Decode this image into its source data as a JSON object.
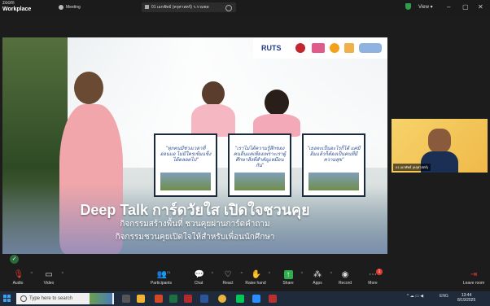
{
  "app": {
    "brand_top": "zoom",
    "brand_bottom": "Workplace"
  },
  "tabs": [
    {
      "label": "Meeting"
    },
    {
      "label": "01 เอกพัทธ์ (ครุศาสตร์) ร.รวมพล"
    }
  ],
  "window": {
    "view_label": "View",
    "minimize": "–",
    "maximize": "▢",
    "close": "✕"
  },
  "share": {
    "logo_text": "RUTS",
    "quotes": [
      "\"ทุกคนมีช่วงเวลาที่อ่อนแอ ไม่มีใครเข้มแข็งได้ตลอดไป\"",
      "\"เราไม่ได้ความรู้สึกของคนอื่นแค่เพียงเพราะเราผู้ศึกษาสิ่งที่สำคัญเหมือนกัน\"",
      "\"เธอจะเป็นอะไรก็ได้ แค่มีอิ่มแล้วก็ต้องเป็นคนที่มีความสุข\""
    ],
    "title": "Deep Talk การ์ดวัยใส เปิดใจชวนคุย",
    "subtitle_1": "กิจกรรมสร้างพื้นที่ ชวนคุยผ่านการ์ดคำถาม",
    "subtitle_2": "กิจกรรมชวนคุยเปิดใจให้สำหรับเพื่อนนักศึกษา"
  },
  "participant_thumb": {
    "name": "01 เอกพัทธ์ (ครุศาสตร์)"
  },
  "toolbar": {
    "audio": "Audio",
    "video": "Video",
    "participants": "Participants",
    "participants_count": "21",
    "chat": "Chat",
    "react": "React",
    "raise_hand": "Raise hand",
    "share": "Share",
    "apps": "Apps",
    "record": "Record",
    "more": "More",
    "more_badge": "1",
    "leave": "Leave room"
  },
  "taskbar": {
    "search_placeholder": "Type here to search",
    "lang": "ENG",
    "time": "13:44",
    "date": "8/19/2025"
  }
}
